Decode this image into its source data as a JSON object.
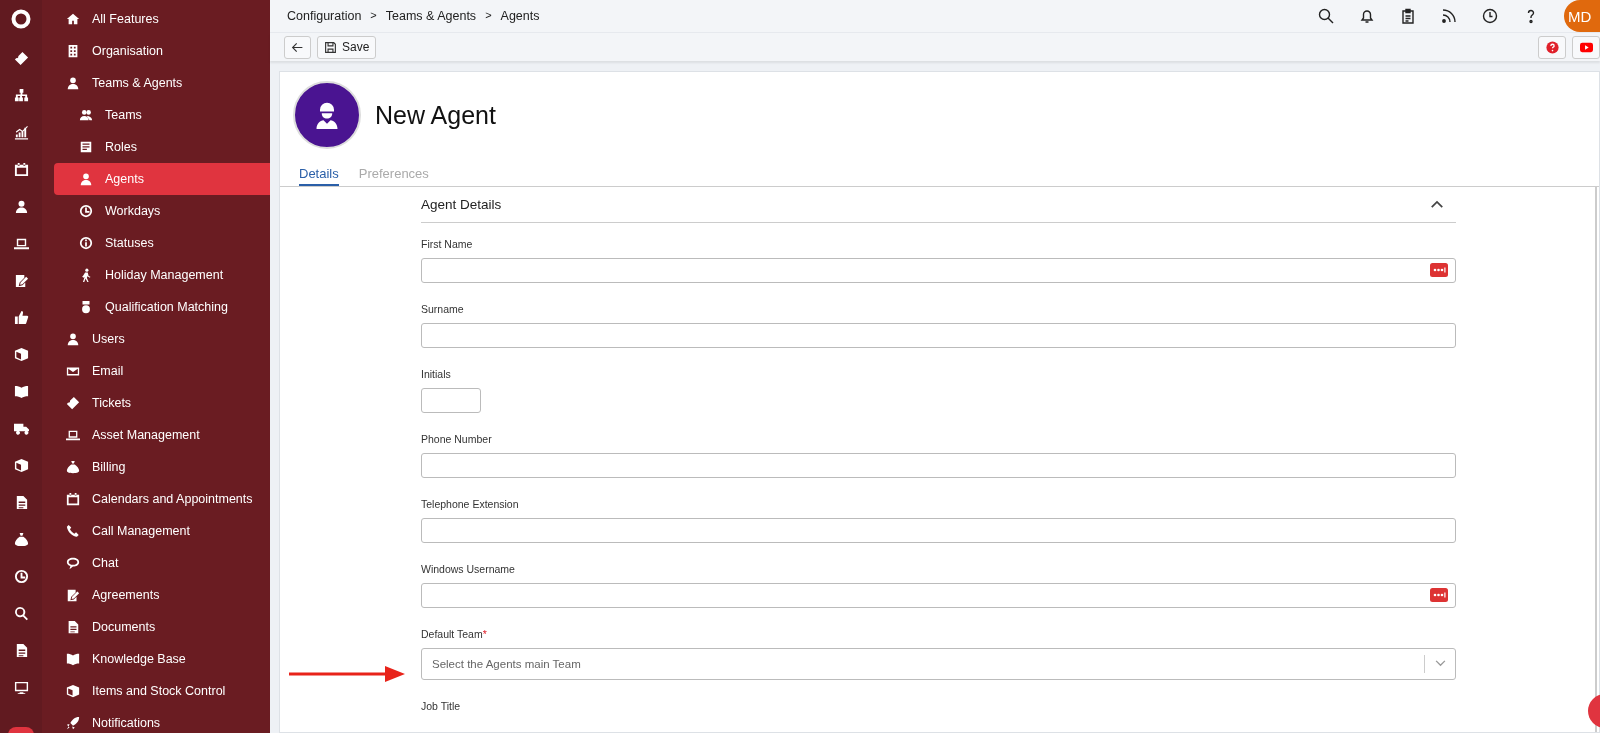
{
  "breadcrumb": [
    "Configuration",
    "Teams & Agents",
    "Agents"
  ],
  "breadcrumb_separator": ">",
  "user": {
    "initials": "MD"
  },
  "toolbar": {
    "save": "Save"
  },
  "nav": [
    {
      "label": "All Features",
      "selected": false
    },
    {
      "label": "Organisation",
      "selected": false
    },
    {
      "label": "Teams & Agents",
      "selected": false,
      "children": [
        {
          "label": "Teams",
          "selected": false
        },
        {
          "label": "Roles",
          "selected": false
        },
        {
          "label": "Agents",
          "selected": true
        },
        {
          "label": "Workdays",
          "selected": false
        },
        {
          "label": "Statuses",
          "selected": false
        },
        {
          "label": "Holiday Management",
          "selected": false
        },
        {
          "label": "Qualification Matching",
          "selected": false
        }
      ]
    },
    {
      "label": "Users",
      "selected": false
    },
    {
      "label": "Email",
      "selected": false
    },
    {
      "label": "Tickets",
      "selected": false
    },
    {
      "label": "Asset Management",
      "selected": false
    },
    {
      "label": "Billing",
      "selected": false
    },
    {
      "label": "Calendars and Appointments",
      "selected": false
    },
    {
      "label": "Call Management",
      "selected": false
    },
    {
      "label": "Chat",
      "selected": false
    },
    {
      "label": "Agreements",
      "selected": false
    },
    {
      "label": "Documents",
      "selected": false
    },
    {
      "label": "Knowledge Base",
      "selected": false
    },
    {
      "label": "Items and Stock Control",
      "selected": false
    },
    {
      "label": "Notifications",
      "selected": false
    }
  ],
  "page": {
    "title": "New Agent"
  },
  "tabs": [
    {
      "label": "Details",
      "selected": true
    },
    {
      "label": "Preferences",
      "selected": false
    }
  ],
  "section": {
    "title": "Agent Details",
    "expanded": true
  },
  "fields": [
    {
      "kind": "text-dots",
      "label": "First Name"
    },
    {
      "kind": "text",
      "label": "Surname"
    },
    {
      "kind": "short",
      "label": "Initials"
    },
    {
      "kind": "text",
      "label": "Phone Number"
    },
    {
      "kind": "text",
      "label": "Telephone Extension"
    },
    {
      "kind": "text-dots",
      "label": "Windows Username"
    },
    {
      "kind": "select",
      "label": "Default Team",
      "required": true,
      "required_mark": "*",
      "placeholder": "Select the Agents main Team"
    },
    {
      "kind": "label",
      "label": "Job Title"
    }
  ]
}
